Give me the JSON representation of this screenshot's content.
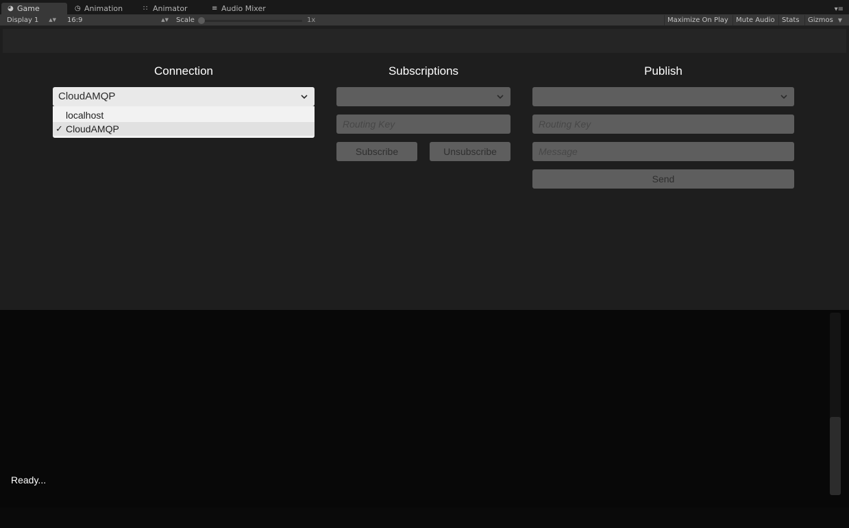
{
  "tabs": [
    {
      "label": "Game",
      "icon": "pacman-icon"
    },
    {
      "label": "Animation",
      "icon": "clock-icon"
    },
    {
      "label": "Animator",
      "icon": "grid-icon"
    },
    {
      "label": "Audio Mixer",
      "icon": "sliders-icon"
    }
  ],
  "toolbar": {
    "display": "Display 1",
    "aspect": "16:9",
    "scale_label": "Scale",
    "scale_value": "1x",
    "maximize": "Maximize On Play",
    "mute": "Mute Audio",
    "stats": "Stats",
    "gizmos": "Gizmos"
  },
  "connection": {
    "title": "Connection",
    "selected": "CloudAMQP",
    "options": [
      "localhost",
      "CloudAMQP"
    ],
    "selected_index": 1
  },
  "subscriptions": {
    "title": "Subscriptions",
    "selected": "",
    "routing_placeholder": "Routing Key",
    "subscribe": "Subscribe",
    "unsubscribe": "Unsubscribe"
  },
  "publish": {
    "title": "Publish",
    "selected": "",
    "routing_placeholder": "Routing Key",
    "message_placeholder": "Message",
    "send": "Send"
  },
  "log": {
    "text": "Ready..."
  },
  "colors": {
    "editor_bg": "#383838",
    "game_bg": "#1e1e1e",
    "log_bg": "#080808",
    "control_dim": "#5e5e5e",
    "control_light": "#e9e9e9"
  }
}
